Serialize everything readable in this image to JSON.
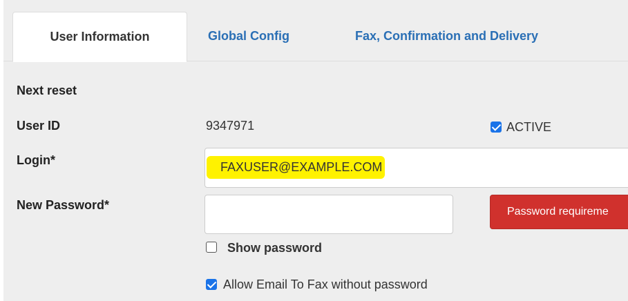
{
  "tabs": [
    {
      "label": "User Information",
      "active": true
    },
    {
      "label": "Global Config",
      "active": false
    },
    {
      "label": "Fax, Confirmation and Delivery",
      "active": false
    }
  ],
  "form": {
    "next_reset_label": "Next reset",
    "user_id_label": "User ID",
    "user_id_value": "9347971",
    "active_label": "ACTIVE",
    "active_checked": true,
    "login_label": "Login*",
    "login_value": "FAXUSER@EXAMPLE.COM",
    "new_password_label": "New Password*",
    "new_password_value": "",
    "password_requirements_button": "Password requireme",
    "show_password_label": "Show password",
    "show_password_checked": false,
    "allow_email_label": "Allow Email To Fax without password",
    "allow_email_checked": true
  },
  "colors": {
    "tab_link": "#2a6fb5",
    "highlight": "#fff200",
    "danger_button": "#d0312d",
    "checkbox_checked": "#1a73e8"
  }
}
